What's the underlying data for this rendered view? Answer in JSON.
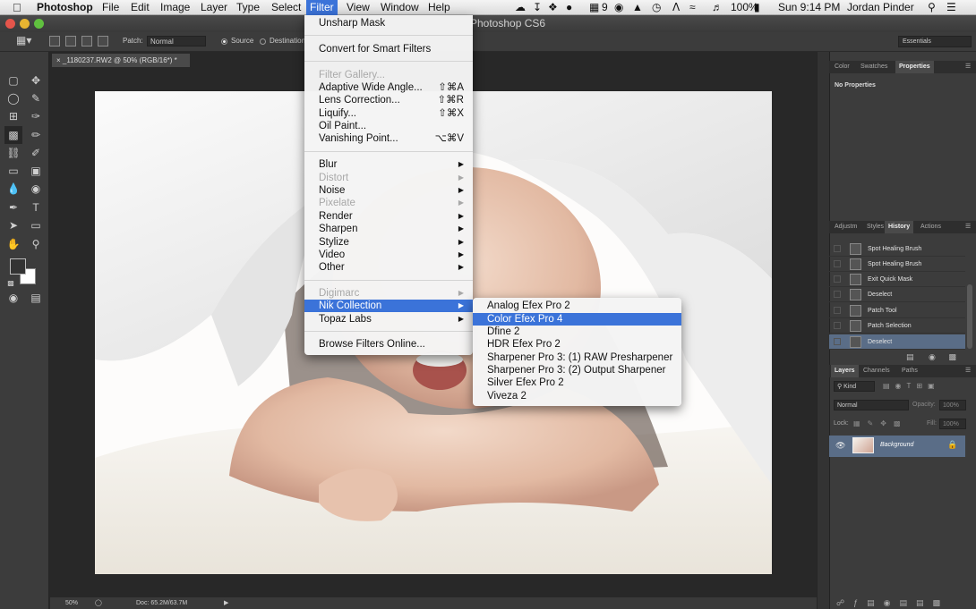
{
  "menubar": {
    "app": "Photoshop",
    "items": [
      "File",
      "Edit",
      "Image",
      "Layer",
      "Type",
      "Select",
      "Filter",
      "View",
      "Window",
      "Help"
    ],
    "status_9": "9",
    "battery": "100%",
    "clock": "Sun 9:14 PM",
    "user": "Jordan Pinder"
  },
  "window": {
    "title": "Photoshop CS6"
  },
  "options": {
    "patch_label": "Patch:",
    "patch_mode": "Normal",
    "source_label": "Source",
    "destination_label": "Destination",
    "workspace": "Essentials"
  },
  "document": {
    "tab": "_1180237.RW2 @ 50% (RGB/16*) *",
    "zoom": "50%",
    "doc_size": "Doc: 65.2M/63.7M"
  },
  "panels": {
    "top_tabs": [
      "Color",
      "Swatches",
      "Properties"
    ],
    "no_properties": "No Properties",
    "mid_tabs": [
      "Adjustm",
      "Styles",
      "History",
      "Actions"
    ],
    "history": [
      "Spot Healing Brush",
      "Spot Healing Brush",
      "Exit Quick Mask",
      "Deselect",
      "Patch Tool",
      "Patch Selection",
      "Deselect"
    ],
    "layer_tabs": [
      "Layers",
      "Channels",
      "Paths"
    ],
    "kind": "Kind",
    "blend": "Normal",
    "opacity_label": "Opacity:",
    "opacity": "100%",
    "lock_label": "Lock:",
    "fill_label": "Fill:",
    "fill": "100%",
    "layer_name": "Background"
  },
  "filter_menu": {
    "unsharp": "Unsharp Mask",
    "smart": "Convert for Smart Filters",
    "gallery": "Filter Gallery...",
    "wide_angle": "Adaptive Wide Angle...",
    "wide_angle_sc": "⇧⌘A",
    "lens": "Lens Correction...",
    "lens_sc": "⇧⌘R",
    "liquify": "Liquify...",
    "liquify_sc": "⇧⌘X",
    "oil": "Oil Paint...",
    "vanishing": "Vanishing Point...",
    "vanishing_sc": "⌥⌘V",
    "blur": "Blur",
    "distort": "Distort",
    "noise": "Noise",
    "pixelate": "Pixelate",
    "render": "Render",
    "sharpen": "Sharpen",
    "stylize": "Stylize",
    "video": "Video",
    "other": "Other",
    "digimarc": "Digimarc",
    "nik": "Nik Collection",
    "topaz": "Topaz Labs",
    "browse": "Browse Filters Online..."
  },
  "nik_menu": [
    "Analog Efex Pro 2",
    "Color Efex Pro 4",
    "Dfine 2",
    "HDR Efex Pro 2",
    "Sharpener Pro 3: (1) RAW Presharpener",
    "Sharpener Pro 3: (2) Output Sharpener",
    "Silver Efex Pro 2",
    "Viveza 2"
  ]
}
